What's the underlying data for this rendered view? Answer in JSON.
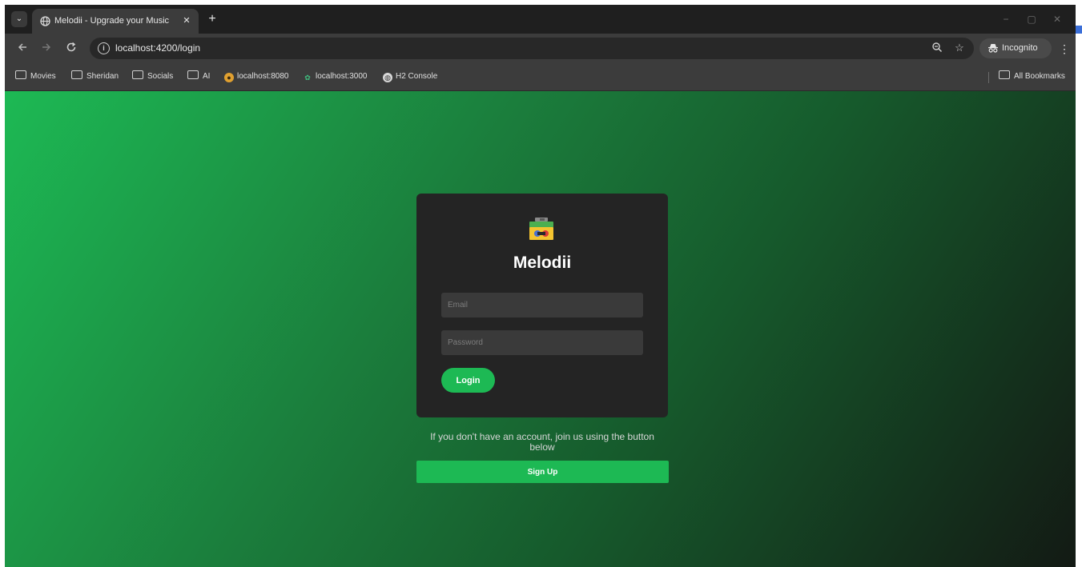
{
  "browser": {
    "tab_search_glyph": "⌄",
    "tab_title": "Melodii - Upgrade your Music",
    "tab_close_glyph": "✕",
    "new_tab_glyph": "+",
    "window_controls": {
      "minimize": "−",
      "maximize": "▢",
      "close": "✕"
    },
    "url": "localhost:4200/login",
    "incognito_label": "Incognito",
    "bookmarks": {
      "movies": "Movies",
      "sheridan": "Sheridan",
      "socials": "Socials",
      "ai": "AI",
      "localhost_8080": "localhost:8080",
      "localhost_3000": "localhost:3000",
      "h2_console": "H2 Console",
      "all_bookmarks": "All Bookmarks"
    }
  },
  "page": {
    "brand": "Melodii",
    "email_placeholder": "Email",
    "password_placeholder": "Password",
    "login_label": "Login",
    "join_text": "If you don't have an account, join us using the button below",
    "signup_label": "Sign Up"
  },
  "colors": {
    "accent": "#1db954",
    "card": "#242424",
    "input": "#3a3a3a"
  }
}
